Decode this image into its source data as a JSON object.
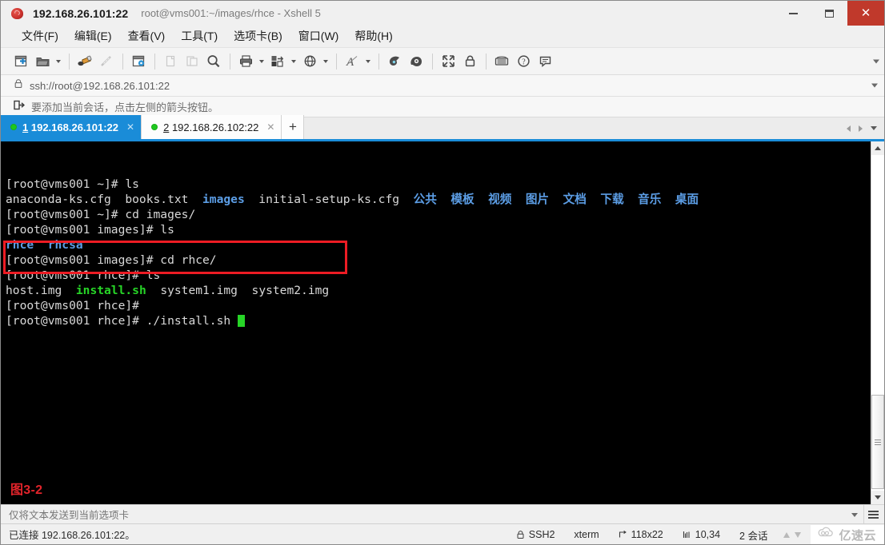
{
  "window": {
    "title_ip": "192.168.26.101:22",
    "title_path": "root@vms001:~/images/rhce - Xshell 5",
    "app_icon": "xshell-icon",
    "minimize_label": "minimize",
    "maximize_label": "maximize",
    "close_label": "✕"
  },
  "menubar": {
    "items": [
      {
        "label": "文件(F)",
        "name": "menu-file"
      },
      {
        "label": "编辑(E)",
        "name": "menu-edit"
      },
      {
        "label": "查看(V)",
        "name": "menu-view"
      },
      {
        "label": "工具(T)",
        "name": "menu-tools"
      },
      {
        "label": "选项卡(B)",
        "name": "menu-tabs"
      },
      {
        "label": "窗口(W)",
        "name": "menu-window"
      },
      {
        "label": "帮助(H)",
        "name": "menu-help"
      }
    ]
  },
  "toolbar": {
    "icons": [
      "new-session-icon",
      "open-folder-icon",
      "transfer-file-icon",
      "disconnect-icon",
      "properties-icon",
      "copy-icon",
      "paste-icon",
      "find-icon",
      "print-icon",
      "layout-icon",
      "globe-icon",
      "font-icon",
      "log-icon",
      "script-icon",
      "fullscreen-icon",
      "lock-icon",
      "keyboard-icon",
      "help-icon",
      "chat-icon"
    ]
  },
  "address": {
    "icon": "lock-icon",
    "value": "ssh://root@192.168.26.101:22"
  },
  "hint": {
    "icon": "add-session-arrow-icon",
    "text": "要添加当前会话，点击左侧的箭头按钮。"
  },
  "tabs": {
    "items": [
      {
        "num": "1",
        "label": "192.168.26.101:22",
        "active": true,
        "status": "connected"
      },
      {
        "num": "2",
        "label": "192.168.26.102:22",
        "active": false,
        "status": "connected"
      }
    ],
    "add_label": "+",
    "close_glyph": "✕"
  },
  "terminal": {
    "lines": [
      [
        {
          "t": "[root@vms001 ~]# ls",
          "c": "white"
        }
      ],
      [
        {
          "t": "anaconda-ks.cfg  books.txt  ",
          "c": "white"
        },
        {
          "t": "images",
          "c": "blue"
        },
        {
          "t": "  initial-setup-ks.cfg  ",
          "c": "white"
        },
        {
          "t": "公共  模板  视频  图片  文档  下载  音乐  桌面",
          "c": "blue"
        }
      ],
      [
        {
          "t": "[root@vms001 ~]# cd images/",
          "c": "white"
        }
      ],
      [
        {
          "t": "[root@vms001 images]# ls",
          "c": "white"
        }
      ],
      [
        {
          "t": "rhce  rhcsa",
          "c": "blue"
        }
      ],
      [
        {
          "t": "[root@vms001 images]# cd rhce/",
          "c": "white"
        }
      ],
      [
        {
          "t": "[root@vms001 rhce]# ls",
          "c": "white"
        }
      ],
      [
        {
          "t": "host.img  ",
          "c": "white"
        },
        {
          "t": "install.sh",
          "c": "green"
        },
        {
          "t": "  system1.img  system2.img",
          "c": "white"
        }
      ],
      [
        {
          "t": "[root@vms001 rhce]#",
          "c": "white"
        }
      ],
      [
        {
          "t": "[root@vms001 rhce]# ./install.sh ",
          "c": "white"
        },
        {
          "t": "",
          "c": "cursor"
        }
      ]
    ],
    "figure_label": "图3-2",
    "highlight_color": "#ed1c24"
  },
  "sendbar": {
    "text": "仅将文本发送到当前选项卡"
  },
  "statusbar": {
    "left": "已连接 192.168.26.101:22。",
    "protocol": "SSH2",
    "terminal_type": "xterm",
    "size": "118x22",
    "cursor_pos": "10,34",
    "sessions": "2 会话",
    "watermark": "亿速云"
  }
}
